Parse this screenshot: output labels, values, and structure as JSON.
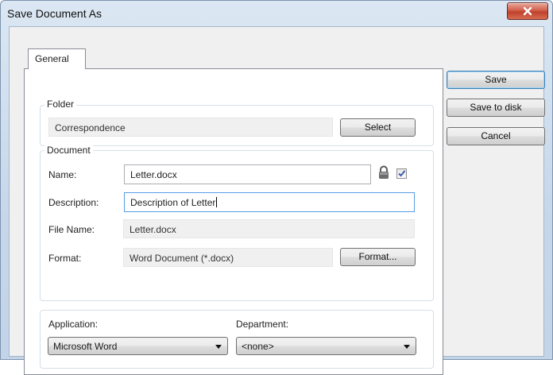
{
  "window": {
    "title": "Save Document As",
    "close_label": "×"
  },
  "tabs": [
    {
      "label": "General"
    }
  ],
  "folder": {
    "group_label": "Folder",
    "value": "Correspondence",
    "select_button": "Select"
  },
  "document": {
    "group_label": "Document",
    "name_label": "Name:",
    "name_value": "Letter.docx",
    "name_checkbox_checked": true,
    "description_label": "Description:",
    "description_value": "Description of Letter",
    "file_name_label": "File Name:",
    "file_name_value": "Letter.docx",
    "format_label": "Format:",
    "format_value": "Word Document (*.docx)",
    "format_button": "Format..."
  },
  "application": {
    "label": "Application:",
    "selected": "Microsoft Word"
  },
  "department": {
    "label": "Department:",
    "selected": "<none>"
  },
  "actions": {
    "save": "Save",
    "save_to_disk": "Save to disk",
    "cancel": "Cancel"
  },
  "icons": {
    "lock": "lock-icon",
    "close": "close-icon",
    "dropdown": "chevron-down-icon"
  },
  "colors": {
    "titlebar": "#c6d7ea",
    "close_button": "#c0412b",
    "focus_border": "#569de5",
    "checkbox_check": "#3b5fa8"
  }
}
